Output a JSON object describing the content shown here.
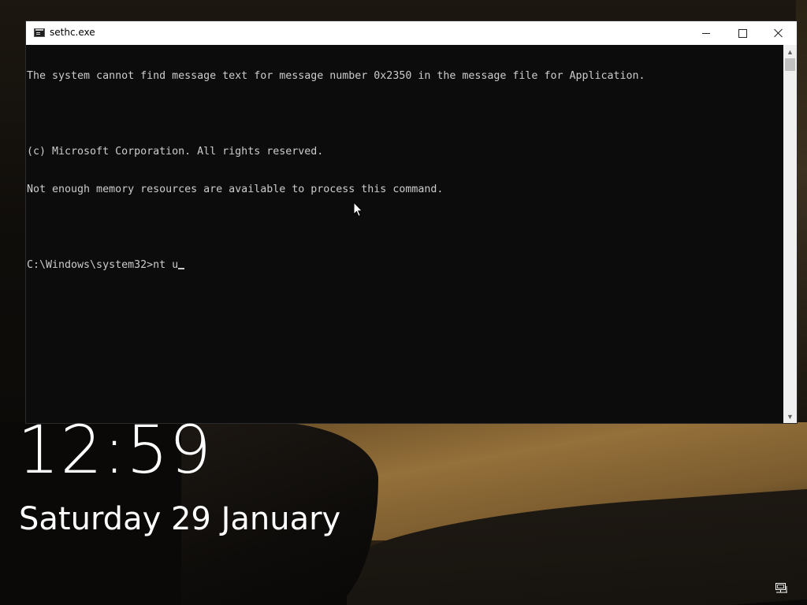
{
  "window": {
    "title": "sethc.exe",
    "icon": "console-icon",
    "controls": {
      "minimize": "minimize-icon",
      "maximize": "maximize-icon",
      "close": "close-icon"
    }
  },
  "console": {
    "lines": [
      "The system cannot find message text for message number 0x2350 in the message file for Application.",
      "",
      "(c) Microsoft Corporation. All rights reserved.",
      "Not enough memory resources are available to process this command.",
      "",
      "C:\\Windows\\system32>nt u"
    ],
    "text_color": "#cccccc",
    "background_color": "#0c0c0c"
  },
  "lock_screen": {
    "time": "12:59",
    "date": "Saturday 29 January",
    "network_icon": "network-icon"
  }
}
